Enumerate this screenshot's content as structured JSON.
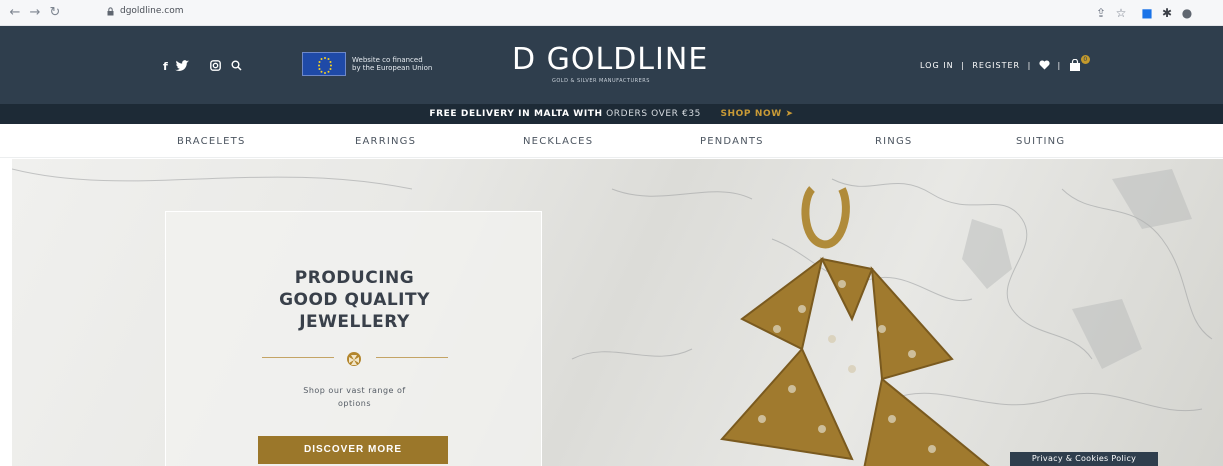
{
  "browser": {
    "url": "dgoldline.com",
    "icons": [
      "back-icon",
      "forward-icon",
      "reload-icon",
      "lock-icon",
      "share-icon",
      "star-icon",
      "extension-icon",
      "puzzle-icon",
      "profile-icon"
    ]
  },
  "header": {
    "social_icons": [
      "facebook-icon",
      "twitter-icon",
      "instagram-icon",
      "search-icon"
    ],
    "eu_text_line1": "Website co financed",
    "eu_text_line2": "by the European Union",
    "logo": "D GOLDLINE",
    "logo_tagline": "GOLD & SILVER MANUFACTURERS",
    "login": "LOG IN",
    "register": "REGISTER",
    "separator": "|",
    "cart_count": "0"
  },
  "promo": {
    "bold": "FREE DELIVERY IN MALTA WITH",
    "rest": "ORDERS OVER €35",
    "shop": "SHOP NOW ➤"
  },
  "categories": [
    "BRACELETS",
    "EARRINGS",
    "NECKLACES",
    "PENDANTS",
    "RINGS",
    "SUITING"
  ],
  "hero": {
    "title_line1": "PRODUCING",
    "title_line2": "GOOD QUALITY",
    "title_line3": "JEWELLERY",
    "subtitle_line1": "Shop our vast range of",
    "subtitle_line2": "options",
    "button": "DISCOVER MORE"
  },
  "privacy": "Privacy & Cookies Policy",
  "colors": {
    "header": "#2f3e4d",
    "promo": "#1d2a36",
    "gold": "#9b772a",
    "accent_gold": "#c99a36"
  }
}
